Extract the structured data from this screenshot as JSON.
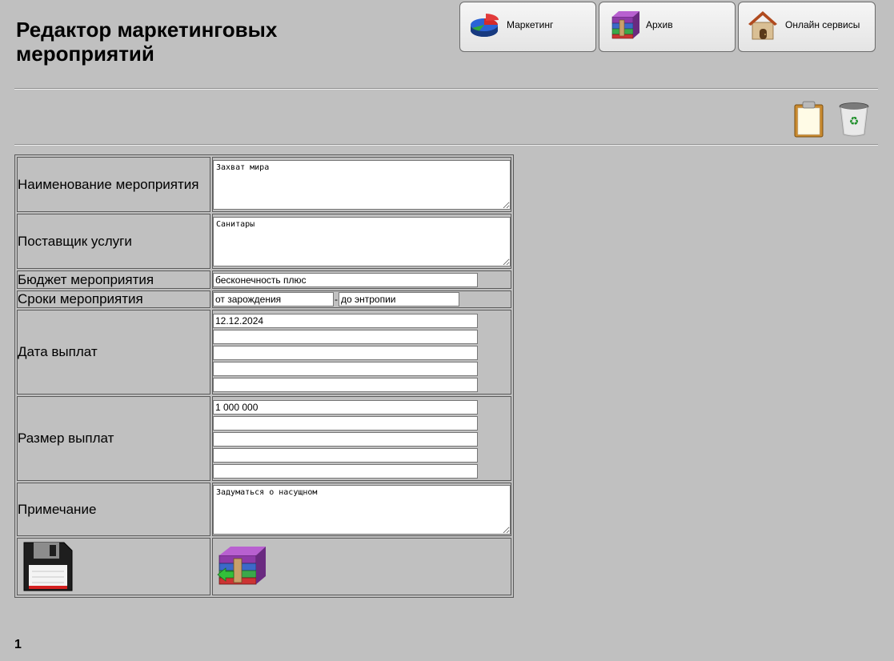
{
  "page": {
    "title": "Редактор маркетинговых мероприятий",
    "page_number": "1"
  },
  "nav": {
    "marketing": {
      "label": "Маркетинг",
      "icon": "pie-chart-icon"
    },
    "archive": {
      "label": "Архив",
      "icon": "archive-icon"
    },
    "online": {
      "label": "Онлайн сервисы",
      "icon": "house-icon"
    }
  },
  "toolbar": {
    "clipboard_icon": "clipboard-icon",
    "trash_icon": "recycle-bin-icon"
  },
  "form": {
    "event_name": {
      "label": "Наименование мероприятия",
      "value": "Захват мира"
    },
    "provider": {
      "label": "Поставщик услуги",
      "value": "Санитары"
    },
    "budget": {
      "label": "Бюджет мероприятия",
      "value": "бесконечность плюс"
    },
    "period": {
      "label": "Сроки мероприятия",
      "from": "от зарождения",
      "to": "до энтропии",
      "separator": "-"
    },
    "payment_dates": {
      "label": "Дата выплат",
      "values": [
        "12.12.2024",
        "",
        "",
        "",
        ""
      ]
    },
    "payment_amounts": {
      "label": "Размер выплат",
      "values": [
        "1 000 000",
        "",
        "",
        "",
        ""
      ]
    },
    "note": {
      "label": "Примечание",
      "value": "Задуматься о насущном"
    },
    "save_icon": "floppy-disk-icon",
    "archive_icon": "archive-icon"
  }
}
